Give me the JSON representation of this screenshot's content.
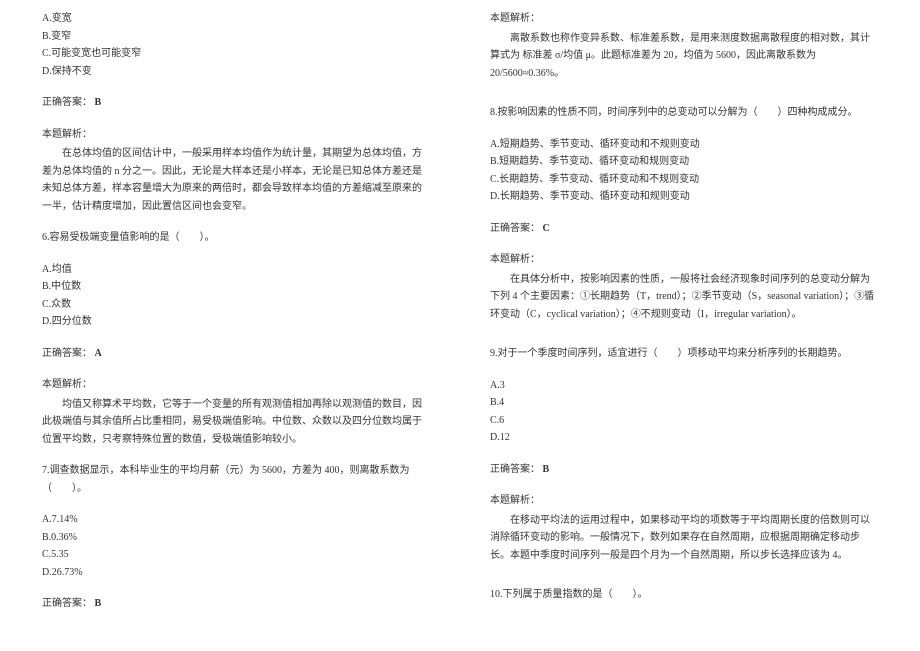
{
  "left": {
    "q5": {
      "options": {
        "a": "A.变宽",
        "b": "B.变窄",
        "c": "C.可能变宽也可能变窄",
        "d": "D.保持不变"
      },
      "answer_label": "正确答案：",
      "answer_value": "B",
      "exp_label": "本题解析：",
      "exp_body": "在总体均值的区间估计中，一般采用样本均值作为统计量，其期望为总体均值，方差为总体均值的 n 分之一。因此，无论是大样本还是小样本，无论是已知总体方差还是未知总体方差，样本容量增大为原来的两倍时，都会导致样本均值的方差缩减至原来的一半，估计精度增加，因此置信区间也会变窄。"
    },
    "q6": {
      "title": "6.容易受极端变量值影响的是（　　）。",
      "options": {
        "a": "A.均值",
        "b": "B.中位数",
        "c": "C.众数",
        "d": "D.四分位数"
      },
      "answer_label": "正确答案：",
      "answer_value": "A",
      "exp_label": "本题解析：",
      "exp_body": "均值又称算术平均数，它等于一个变量的所有观测值相加再除以观测值的数目，因此极端值与其余值所占比重相同，易受极端值影响。中位数、众数以及四分位数均属于位置平均数，只考察特殊位置的数值，受极端值影响较小。"
    },
    "q7": {
      "title": "7.调查数据显示，本科毕业生的平均月薪（元）为 5600，方差为 400，则离散系数为（　　）。",
      "options": {
        "a": "A.7.14%",
        "b": "B.0.36%",
        "c": "C.5.35",
        "d": "D.26.73%"
      },
      "answer_label": "正确答案：",
      "answer_value": "B"
    }
  },
  "right": {
    "q7": {
      "exp_label": "本题解析：",
      "exp_body": "离散系数也称作变异系数、标准差系数，是用来测度数据离散程度的相对数，其计算式为 标准差 σ/均值 μ。此题标准差为 20，均值为 5600，因此离散系数为 20/5600≈0.36%。"
    },
    "q8": {
      "title": "8.按影响因素的性质不同，时间序列中的总变动可以分解为（　　）四种构成成分。",
      "options": {
        "a": "A.短期趋势、季节变动、循环变动和不规则变动",
        "b": "B.短期趋势、季节变动、循环变动和规则变动",
        "c": "C.长期趋势、季节变动、循环变动和不规则变动",
        "d": "D.长期趋势、季节变动、循环变动和规则变动"
      },
      "answer_label": "正确答案：",
      "answer_value": "C",
      "exp_label": "本题解析：",
      "exp_body": "在具体分析中，按影响因素的性质，一般将社会经济现象时间序列的总变动分解为下列 4 个主要因素：①长期趋势（T，trend）；②季节变动（S，seasonal variation）；③循环变动（C，cyclical variation）；④不规则变动（I，irregular variation）。"
    },
    "q9": {
      "title": "9.对于一个季度时间序列，适宜进行（　　）项移动平均来分析序列的长期趋势。",
      "options": {
        "a": "A.3",
        "b": "B.4",
        "c": "C.6",
        "d": "D.12"
      },
      "answer_label": "正确答案：",
      "answer_value": "B",
      "exp_label": "本题解析：",
      "exp_body": "在移动平均法的运用过程中，如果移动平均的项数等于平均周期长度的倍数则可以消除循环变动的影响。一般情况下，数列如果存在自然周期，应根据周期确定移动步长。本题中季度时间序列一般是四个月为一个自然周期，所以步长选择应该为 4。"
    },
    "q10": {
      "title": "10.下列属于质量指数的是（　　）。"
    }
  }
}
